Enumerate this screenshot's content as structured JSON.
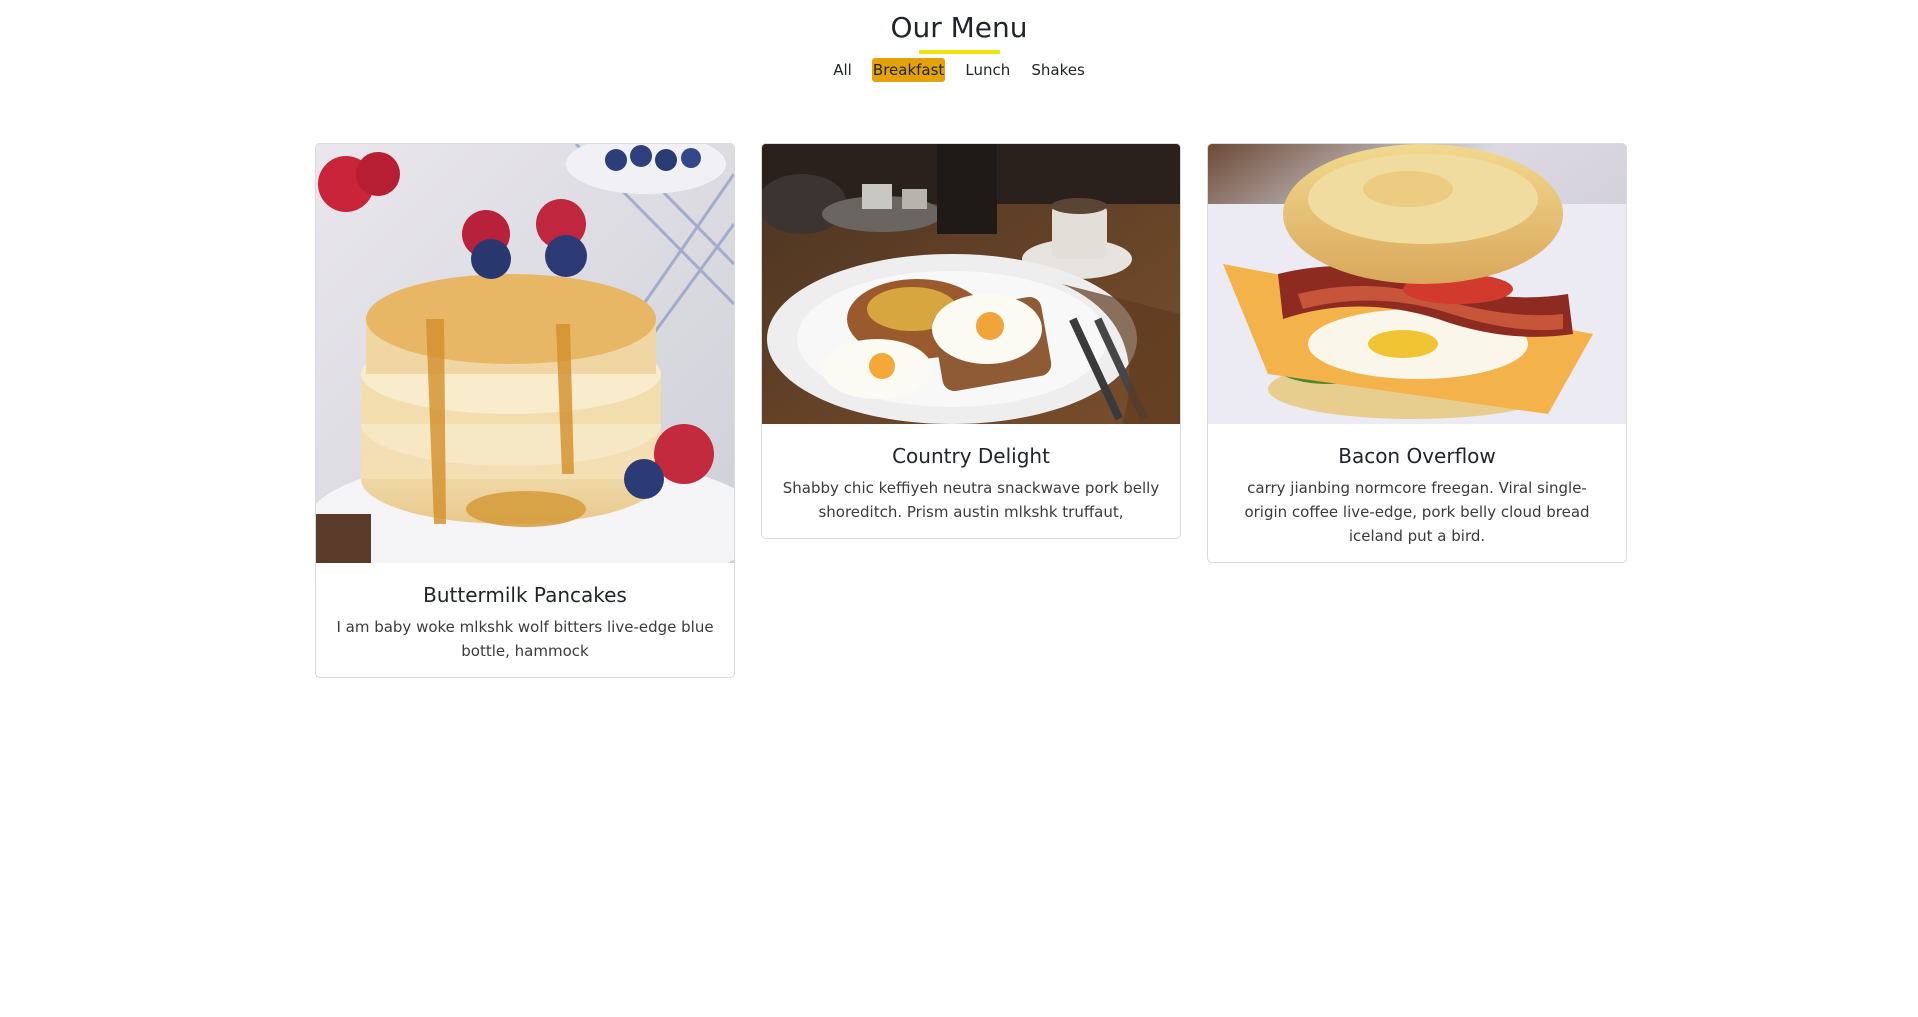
{
  "header": {
    "title": "Our Menu",
    "accent_color": "#f0e40c"
  },
  "filters": {
    "items": [
      {
        "label": "All",
        "active": false
      },
      {
        "label": "Breakfast",
        "active": true
      },
      {
        "label": "Lunch",
        "active": false
      },
      {
        "label": "Shakes",
        "active": false
      }
    ],
    "active_color": "#e3a20a"
  },
  "menu_items": [
    {
      "title": "Buttermilk Pancakes",
      "description": "I am baby woke mlkshk wolf bitters live-edge blue bottle, hammock",
      "image_icon": "pancakes-photo"
    },
    {
      "title": "Country Delight",
      "description": "Shabby chic keffiyeh neutra snackwave pork belly shoreditch. Prism austin mlkshk truffaut,",
      "image_icon": "breakfast-plate-photo"
    },
    {
      "title": "Bacon Overflow",
      "description": "carry jianbing normcore freegan. Viral single-origin coffee live-edge, pork belly cloud bread iceland put a bird.",
      "image_icon": "bacon-sandwich-photo"
    }
  ]
}
